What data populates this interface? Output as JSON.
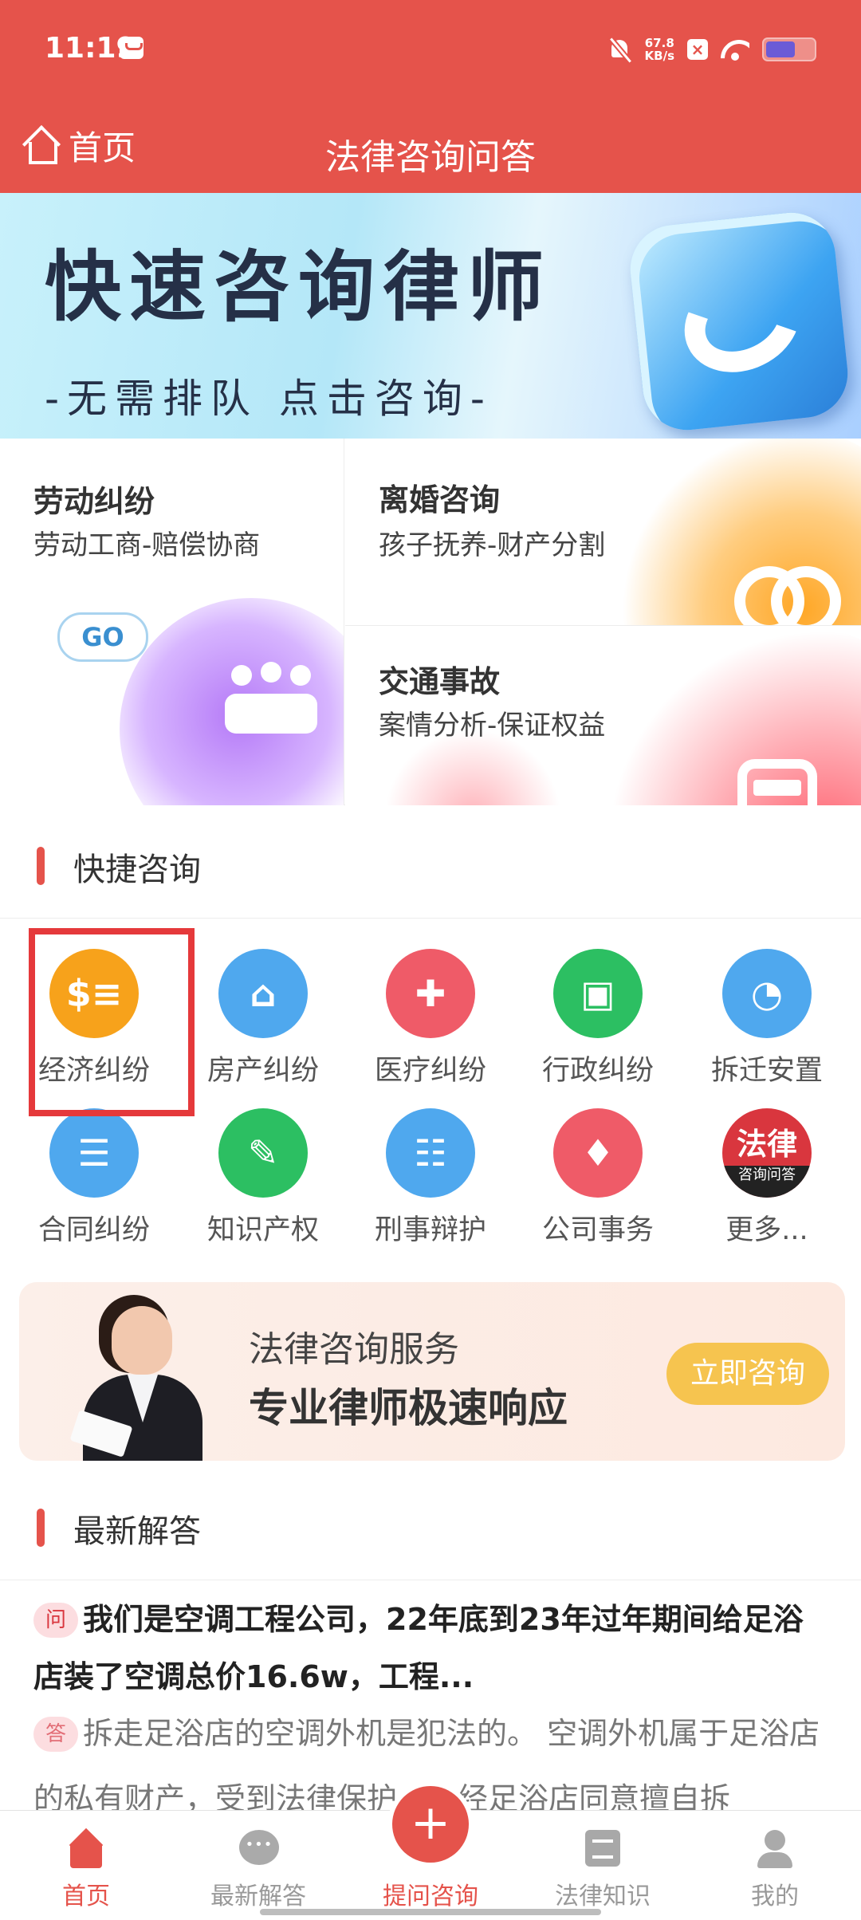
{
  "status_bar": {
    "time": "11:19",
    "net_speed_value": "67.8",
    "net_speed_unit": "KB/s",
    "battery_level": 0.62
  },
  "header": {
    "home_label": "首页",
    "title": "法律咨询问答"
  },
  "banner": {
    "title": "快速咨询律师",
    "subtitle": "-无需排队  点击咨询-"
  },
  "categories": [
    {
      "title": "劳动纠纷",
      "subtitle": "劳动工商-赔偿协商",
      "button": "GO"
    },
    {
      "title": "离婚咨询",
      "subtitle": "孩子抚养-财产分割"
    },
    {
      "title": "交通事故",
      "subtitle": "案情分析-保证权益"
    }
  ],
  "quick": {
    "title": "快捷咨询",
    "items": [
      {
        "label": "经济纠纷",
        "color": "#f7a21b",
        "icon": "money-receipt-icon",
        "symbol": "$≡"
      },
      {
        "label": "房产纠纷",
        "color": "#4fa8ee",
        "icon": "house-icon",
        "symbol": "⌂"
      },
      {
        "label": "医疗纠纷",
        "color": "#ef5b68",
        "icon": "injured-person-icon",
        "symbol": "✚"
      },
      {
        "label": "行政纠纷",
        "color": "#2cbf62",
        "icon": "briefcase-icon",
        "symbol": "▣"
      },
      {
        "label": "拆迁安置",
        "color": "#4fa8ee",
        "icon": "pie-chart-icon",
        "symbol": "◔"
      },
      {
        "label": "合同纠纷",
        "color": "#4fa8ee",
        "icon": "document-icon",
        "symbol": "☰"
      },
      {
        "label": "知识产权",
        "color": "#2cbf62",
        "icon": "edit-document-icon",
        "symbol": "✎"
      },
      {
        "label": "刑事辩护",
        "color": "#4fa8ee",
        "icon": "certificate-icon",
        "symbol": "☷"
      },
      {
        "label": "公司事务",
        "color": "#ef5b68",
        "icon": "tie-icon",
        "symbol": "♦"
      },
      {
        "label": "更多...",
        "color": "#d9363e",
        "icon": "law-logo-icon",
        "logo_big": "法律",
        "logo_small": "咨询问答"
      }
    ]
  },
  "promo": {
    "line1": "法律咨询服务",
    "line2": "专业律师极速响应",
    "button": "立即咨询"
  },
  "latest": {
    "title": "最新解答",
    "q_tag": "问",
    "a_tag": "答",
    "question": "我们是空调工程公司，22年底到23年过年期间给足浴店装了空调总价16.6w，工程...",
    "answer": "拆走足浴店的空调外机是犯法的。 空调外机属于足浴店的私有财产，受到法律保护。未经足浴店同意擅自拆"
  },
  "tabbar": {
    "items": [
      {
        "label": "首页",
        "icon": "home-icon"
      },
      {
        "label": "最新解答",
        "icon": "chat-bubble-icon"
      },
      {
        "label": "提问咨询",
        "icon": "plus-icon",
        "symbol": "+"
      },
      {
        "label": "法律知识",
        "icon": "book-icon"
      },
      {
        "label": "我的",
        "icon": "user-icon"
      }
    ]
  }
}
